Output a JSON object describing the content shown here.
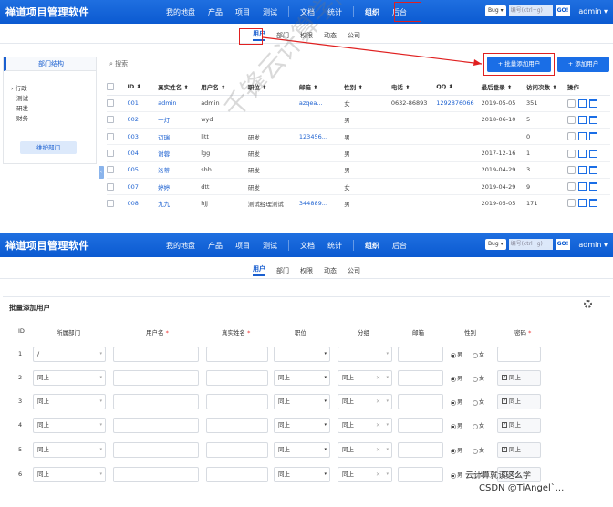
{
  "brand": "禅道项目管理软件",
  "nav": {
    "items": [
      "我的地盘",
      "产品",
      "项目",
      "测试",
      "文档",
      "统计",
      "组织",
      "后台"
    ],
    "active": "组织",
    "bug_select": "Bug",
    "search_placeholder": "编号(ctrl+g)",
    "go_label": "GO!",
    "user_label": "admin"
  },
  "subnav": {
    "items": [
      "用户",
      "部门",
      "权限",
      "动态",
      "公司"
    ],
    "active": "用户"
  },
  "dept_panel": {
    "title": "部门结构",
    "items": [
      "行政",
      "测试",
      "研发",
      "财务"
    ],
    "maintain_button": "维护部门"
  },
  "search_label": "搜索",
  "buttons": {
    "batch_add": "+ 批量添加用户",
    "add_user": "+ 添加用户"
  },
  "user_table": {
    "headers": [
      "ID ⬍",
      "真实姓名 ⬍",
      "用户名 ⬍",
      "职位 ⬍",
      "邮箱 ⬍",
      "性别 ⬍",
      "电话 ⬍",
      "QQ ⬍",
      "最后登录 ⬍",
      "访问次数 ⬍",
      "操作"
    ],
    "rows": [
      [
        "001",
        "admin",
        "admin",
        "",
        "azqea...",
        "女",
        "0632-86893",
        "1292876066",
        "2019-05-05",
        "351"
      ],
      [
        "002",
        "一灯",
        "wyd",
        "",
        "",
        "男",
        "",
        "",
        "2018-06-10",
        "5"
      ],
      [
        "003",
        "迈瑞",
        "litt",
        "研发",
        "123456...",
        "男",
        "",
        "",
        "",
        "0"
      ],
      [
        "004",
        "谢蓉",
        "lgg",
        "研发",
        "",
        "男",
        "",
        "",
        "2017-12-16",
        "1"
      ],
      [
        "005",
        "洛蒂",
        "shh",
        "研发",
        "",
        "男",
        "",
        "",
        "2019-04-29",
        "3"
      ],
      [
        "007",
        "婷婷",
        "dtt",
        "研发",
        "",
        "女",
        "",
        "",
        "2019-04-29",
        "9"
      ],
      [
        "008",
        "九九",
        "hjj",
        "测试经理测试",
        "344889...",
        "男",
        "",
        "",
        "2019-05-05",
        "171"
      ]
    ]
  },
  "watermark_main": "千锋云计算学院",
  "batch": {
    "title": "批量添加用户",
    "headers": {
      "id": "ID",
      "dept": "所属部门",
      "account": "用户名",
      "realname": "真实姓名",
      "role": "职位",
      "group": "分组",
      "email": "邮箱",
      "gender": "性别",
      "password": "密码"
    },
    "gender_male": "男",
    "gender_female": "女",
    "ditto": "同上",
    "first_dept": "/",
    "rows": [
      "1",
      "2",
      "3",
      "4",
      "5",
      "6"
    ]
  },
  "footer_watermark_1": "云计算就该这么学",
  "footer_watermark_2": "CSDN @TiAngel`..."
}
